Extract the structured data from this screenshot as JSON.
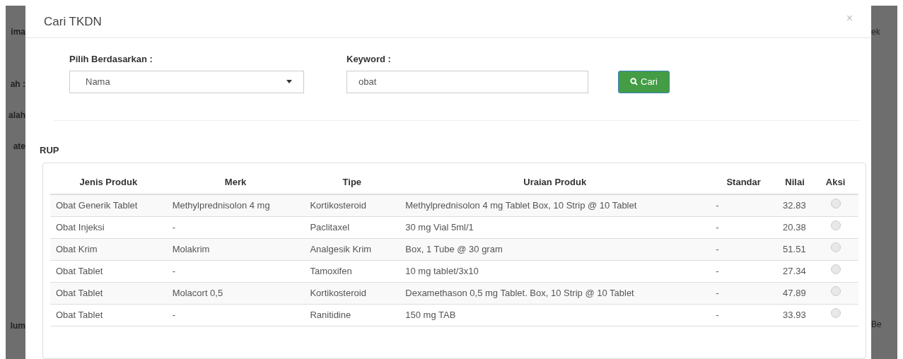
{
  "background": {
    "left_fragments": [
      "ima",
      "ah :",
      "alah",
      "ate",
      "lum"
    ],
    "right_fragments": [
      "ek",
      "Be"
    ]
  },
  "modal": {
    "title": "Cari TKDN",
    "close": "×",
    "filter": {
      "select_label": "Pilih Berdasarkan :",
      "select_value": "Nama",
      "keyword_label": "Keyword :",
      "keyword_value": "obat",
      "button": "Cari"
    },
    "section_title": "RUP",
    "table": {
      "columns": [
        "Jenis Produk",
        "Merk",
        "Tipe",
        "Uraian Produk",
        "Standar",
        "Nilai",
        "Aksi"
      ],
      "rows": [
        {
          "cells": [
            "Obat Generik Tablet",
            "Methylprednisolon 4 mg",
            "Kortikosteroid",
            "Methylprednisolon 4 mg Tablet Box, 10 Strip @ 10 Tablet",
            "-",
            "32.83"
          ],
          "selected": false
        },
        {
          "cells": [
            "Obat Injeksi",
            "-",
            "Paclitaxel",
            "30 mg Vial 5ml/1",
            "-",
            "20.38"
          ],
          "selected": false
        },
        {
          "cells": [
            "Obat Krim",
            "Molakrim",
            "Analgesik Krim",
            "Box, 1 Tube @ 30 gram",
            "-",
            "51.51"
          ],
          "selected": false
        },
        {
          "cells": [
            "Obat Tablet",
            "-",
            "Tamoxifen",
            "10 mg tablet/3x10",
            "-",
            "27.34"
          ],
          "selected": false
        },
        {
          "cells": [
            "Obat Tablet",
            "Molacort 0,5",
            "Kortikosteroid",
            "Dexamethason 0,5 mg Tablet. Box, 10 Strip @ 10 Tablet",
            "-",
            "47.89"
          ],
          "selected": false
        },
        {
          "cells": [
            "Obat Tablet",
            "-",
            "Ranitidine",
            "150 mg TAB",
            "-",
            "33.93"
          ],
          "selected": false
        }
      ]
    }
  }
}
